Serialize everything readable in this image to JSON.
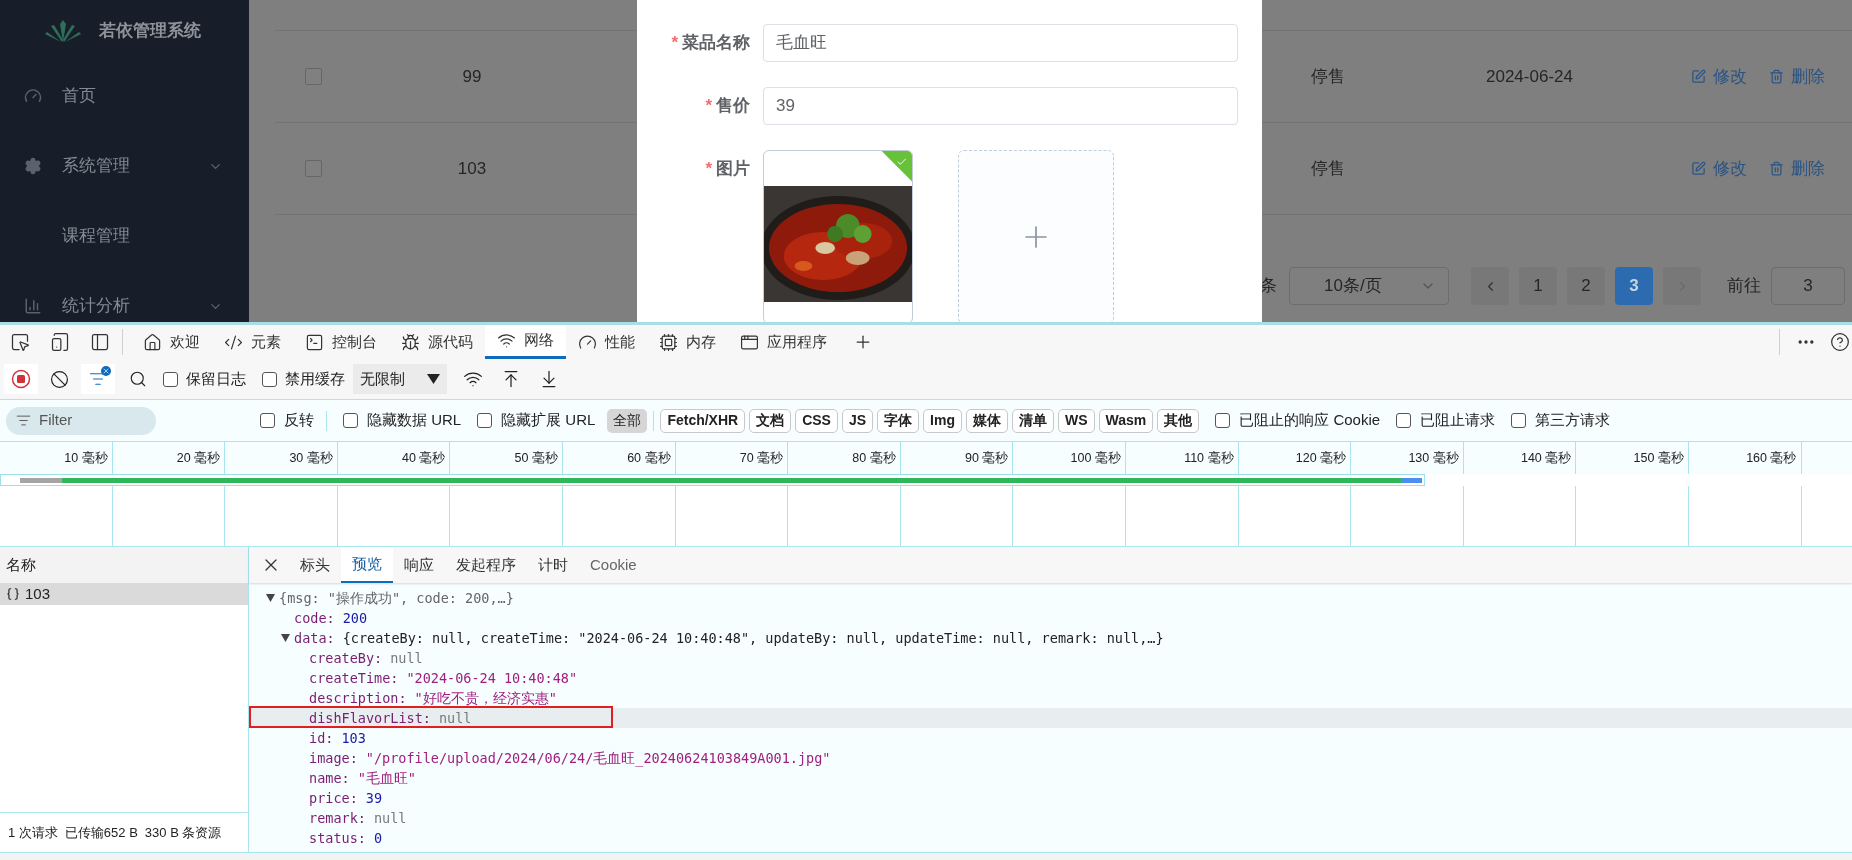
{
  "sidebar": {
    "title": "若依管理系统",
    "items": [
      {
        "label": "首页",
        "has_arrow": false
      },
      {
        "label": "系统管理",
        "has_arrow": true,
        "children": [
          {
            "label": "课程管理"
          }
        ]
      },
      {
        "label": "统计分析",
        "has_arrow": true
      }
    ]
  },
  "table": {
    "rows": [
      {
        "checked": false,
        "id": "99",
        "status": "停售",
        "date": "2024-06-24",
        "actions": [
          "修改",
          "删除"
        ]
      },
      {
        "checked": false,
        "id": "103",
        "status": "停售",
        "actions": [
          "修改",
          "删除"
        ]
      }
    ]
  },
  "pagination": {
    "total_suffix": "条",
    "page_size": "10条/页",
    "pages": [
      {
        "label": "1",
        "selected": false
      },
      {
        "label": "2",
        "selected": false
      },
      {
        "label": "3",
        "selected": true
      }
    ],
    "goto_label": "前往",
    "goto_value": "3"
  },
  "dialog": {
    "fields": [
      {
        "required_mark": "*",
        "label": "菜品名称",
        "value": "毛血旺"
      },
      {
        "required_mark": "*",
        "label": "售价",
        "value": "39"
      }
    ],
    "image_field": {
      "required_mark": "*",
      "label": "图片",
      "uploaded": true
    }
  },
  "devtools": {
    "tabs": [
      {
        "label": "欢迎",
        "selected": false
      },
      {
        "label": "元素",
        "selected": false
      },
      {
        "label": "控制台",
        "selected": false
      },
      {
        "label": "源代码",
        "selected": false
      },
      {
        "label": "网络",
        "selected": true
      },
      {
        "label": "性能",
        "selected": false
      },
      {
        "label": "内存",
        "selected": false
      },
      {
        "label": "应用程序",
        "selected": false
      }
    ],
    "toolbar": {
      "recording": true,
      "checkboxes": [
        {
          "label": "保留日志",
          "checked": false
        },
        {
          "label": "禁用缓存",
          "checked": false
        }
      ],
      "throttle": "无限制"
    },
    "filter": {
      "placeholder": "Filter",
      "checkboxes": [
        {
          "label": "反转",
          "checked": false
        },
        {
          "label": "隐藏数据 URL",
          "checked": false
        },
        {
          "label": "隐藏扩展 URL",
          "checked": false
        }
      ],
      "types": [
        {
          "label": "全部",
          "selected": true
        },
        {
          "label": "Fetch/XHR",
          "selected": false
        },
        {
          "label": "文档",
          "selected": false
        },
        {
          "label": "CSS",
          "selected": false
        },
        {
          "label": "JS",
          "selected": false
        },
        {
          "label": "字体",
          "selected": false
        },
        {
          "label": "Img",
          "selected": false
        },
        {
          "label": "媒体",
          "selected": false
        },
        {
          "label": "清单",
          "selected": false
        },
        {
          "label": "WS",
          "selected": false
        },
        {
          "label": "Wasm",
          "selected": false
        },
        {
          "label": "其他",
          "selected": false
        }
      ],
      "more_checkboxes": [
        {
          "label": "已阻止的响应 Cookie",
          "checked": false
        },
        {
          "label": "已阻止请求",
          "checked": false
        },
        {
          "label": "第三方请求",
          "checked": false
        }
      ]
    },
    "timeline": {
      "ticks": [
        "10 毫秒",
        "20 毫秒",
        "30 毫秒",
        "40 毫秒",
        "50 毫秒",
        "60 毫秒",
        "70 毫秒",
        "80 毫秒",
        "90 毫秒",
        "100 毫秒",
        "110 毫秒",
        "120 毫秒",
        "130 毫秒",
        "140 毫秒",
        "150 毫秒",
        "160 毫秒"
      ]
    },
    "requests": {
      "header": "名称",
      "rows": [
        {
          "name": "103",
          "selected": true
        }
      ],
      "footer": [
        "1 次请求",
        "已传输652 B",
        "330 B 条资源"
      ]
    },
    "detail": {
      "tabs": [
        {
          "label": "标头",
          "selected": false
        },
        {
          "label": "预览",
          "selected": true
        },
        {
          "label": "响应",
          "selected": false
        },
        {
          "label": "发起程序",
          "selected": false
        },
        {
          "label": "计时",
          "selected": false
        },
        {
          "label": "Cookie",
          "selected": false
        }
      ],
      "tree": {
        "preview": "{msg: \"操作成功\", code: 200,…}",
        "expanded": true,
        "children": [
          {
            "key": "code:",
            "value": "200",
            "kind": "number"
          },
          {
            "key": "data:",
            "preview": "{createBy: null, createTime: \"2024-06-24 10:40:48\", updateBy: null, updateTime: null, remark: null,…}",
            "expanded": true,
            "children": [
              {
                "key": "createBy:",
                "value": "null",
                "kind": "null"
              },
              {
                "key": "createTime:",
                "value": "\"2024-06-24 10:40:48\"",
                "kind": "string"
              },
              {
                "key": "description:",
                "value": "\"好吃不贵，经济实惠\"",
                "kind": "string"
              },
              {
                "key": "dishFlavorList:",
                "value": "null",
                "kind": "null",
                "selected": true,
                "annotated": true
              },
              {
                "key": "id:",
                "value": "103",
                "kind": "number"
              },
              {
                "key": "image:",
                "value": "\"/profile/upload/2024/06/24/毛血旺_20240624103849A001.jpg\"",
                "kind": "string"
              },
              {
                "key": "name:",
                "value": "\"毛血旺\"",
                "kind": "string"
              },
              {
                "key": "price:",
                "value": "39",
                "kind": "number"
              },
              {
                "key": "remark:",
                "value": "null",
                "kind": "null"
              },
              {
                "key": "status:",
                "value": "0",
                "kind": "number"
              }
            ]
          }
        ]
      }
    }
  }
}
